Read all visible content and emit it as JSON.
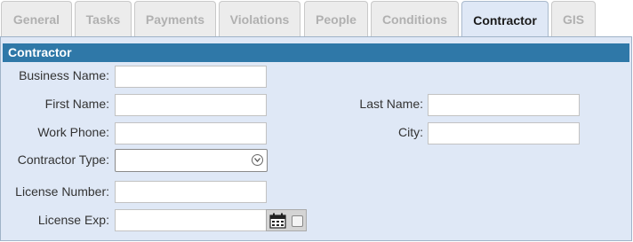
{
  "tabs": [
    {
      "label": "General"
    },
    {
      "label": "Tasks"
    },
    {
      "label": "Payments"
    },
    {
      "label": "Violations"
    },
    {
      "label": "People"
    },
    {
      "label": "Conditions"
    },
    {
      "label": "Contractor",
      "active": true
    },
    {
      "label": "GIS"
    }
  ],
  "panel": {
    "title": "Contractor"
  },
  "form": {
    "business_name": {
      "label": "Business Name:",
      "value": ""
    },
    "first_name": {
      "label": "First Name:",
      "value": ""
    },
    "last_name": {
      "label": "Last Name:",
      "value": ""
    },
    "work_phone": {
      "label": "Work Phone:",
      "value": ""
    },
    "city": {
      "label": "City:",
      "value": ""
    },
    "contractor_type": {
      "label": "Contractor Type:",
      "value": ""
    },
    "license_number": {
      "label": "License Number:",
      "value": ""
    },
    "license_exp": {
      "label": "License Exp:",
      "value": ""
    }
  },
  "icons": {
    "dropdown": "chevron-down-circle-icon",
    "date_picker": "calendar-icon",
    "checkbox": "checkbox"
  },
  "colors": {
    "header_bar": "#2f78a8",
    "panel_bg": "#dfe8f6",
    "active_tab_bg": "#dfe8f6",
    "inactive_tab_text": "#b0b0b0"
  }
}
